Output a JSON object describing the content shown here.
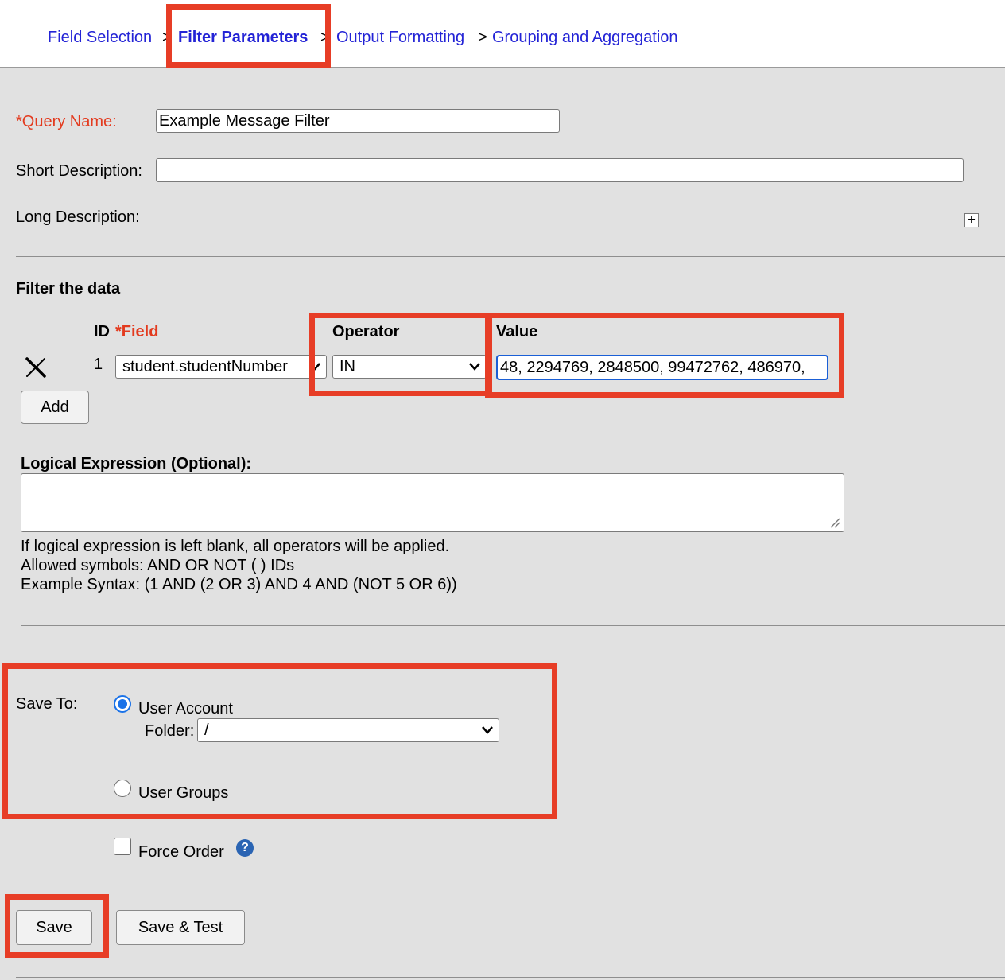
{
  "breadcrumb": {
    "items": [
      "Field Selection",
      "Filter Parameters",
      "Output Formatting",
      "Grouping and Aggregation"
    ],
    "separators": [
      ">",
      ">",
      ">"
    ],
    "active_index": 1
  },
  "form": {
    "query_name_label": "*Query Name:",
    "query_name_value": "Example Message Filter",
    "short_desc_label": "Short Description:",
    "short_desc_value": "",
    "long_desc_label": "Long Description:",
    "expand_icon": "+"
  },
  "filter": {
    "section_title": "Filter the data",
    "col_id": "ID",
    "col_field": "*Field",
    "col_operator": "Operator",
    "col_value": "Value",
    "rows": [
      {
        "id": "1",
        "field": "student.studentNumber",
        "operator": "IN",
        "value": "48, 2294769, 2848500, 99472762, 486970,"
      }
    ],
    "add_label": "Add"
  },
  "logical": {
    "label": "Logical Expression (Optional):",
    "value": "",
    "help_lines": [
      "If logical expression is left blank, all operators will be applied.",
      "Allowed symbols: AND OR NOT ( ) IDs",
      "Example Syntax: (1 AND (2 OR 3) AND 4 AND (NOT 5 OR 6))"
    ]
  },
  "save_to": {
    "label": "Save To:",
    "user_account_label": "User Account",
    "folder_label": "Folder:",
    "folder_value": "/",
    "user_groups_label": "User Groups",
    "selected": "user_account"
  },
  "force_order": {
    "label": "Force Order",
    "checked": false,
    "help_icon": "?"
  },
  "buttons": {
    "save": "Save",
    "save_test": "Save & Test"
  },
  "colors": {
    "link": "#2323d6",
    "required": "#e33a1e",
    "highlight": "#e73d26",
    "radio_selected": "#1a72e8"
  }
}
